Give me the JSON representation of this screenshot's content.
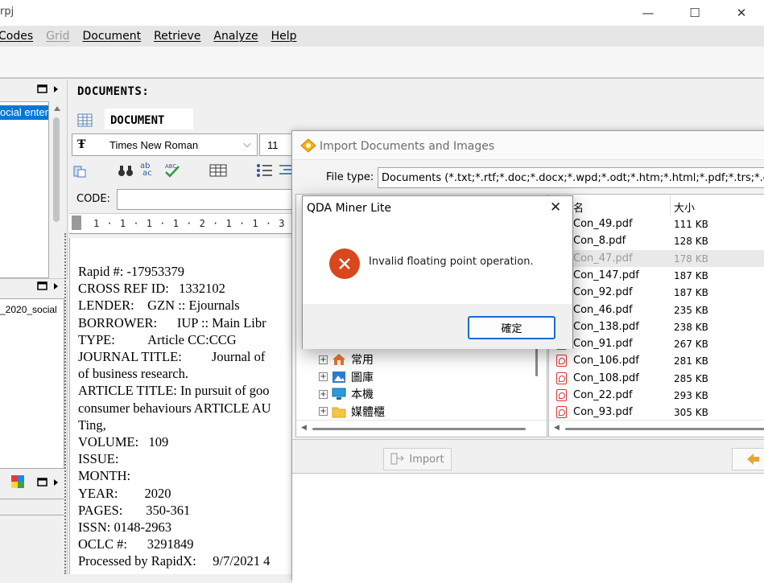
{
  "window": {
    "title": "rpj",
    "minimize": "—",
    "maximize": "☐",
    "close": "✕"
  },
  "menu": [
    {
      "label": "Codes",
      "disabled": false
    },
    {
      "label": "Grid",
      "disabled": true
    },
    {
      "label": "Document",
      "disabled": false
    },
    {
      "label": "Retrieve",
      "disabled": false
    },
    {
      "label": "Analyze",
      "disabled": false
    },
    {
      "label": "Help",
      "disabled": false
    }
  ],
  "left_panels": {
    "top_item": "ocial enter",
    "mid_item": "_2020_social"
  },
  "documents": {
    "header": "DOCUMENTS:",
    "tab": "DOCUMENT",
    "font": "Times New Roman",
    "size": "11",
    "code_label": "CODE:",
    "ruler": "1 · 1 · 1 · 1 · 2 · 1 · 1 · 3 · 1 · 1 · 4 · 1 · 1 · 5 · 1",
    "lines": [
      "Rapid #: -17953379",
      "CROSS REF ID:   1332102",
      "LENDER:    GZN :: Ejournals",
      "BORROWER:      IUP :: Main Libr",
      "TYPE:          Article CC:CCG",
      "JOURNAL TITLE:         Journal of",
      "of business research.",
      "ARTICLE TITLE: In pursuit of goo",
      "consumer behaviours ARTICLE AU",
      "Ting,",
      "VOLUME:   109",
      "ISSUE:",
      "MONTH:",
      "YEAR:        2020",
      "PAGES:       350-361",
      "ISSN: 0148-2963",
      "OCLC #:      3291849",
      "Processed by RapidX:     9/7/2021 4"
    ]
  },
  "import_dialog": {
    "title": "Import Documents and Images",
    "file_type_label": "File type:",
    "file_type_value": "Documents (*.txt;*.rtf;*.doc;*.docx;*.wpd;*.odt;*.htm;*.html;*.pdf;*.trs;*.c",
    "col_name": "名",
    "col_size": "大小",
    "files": [
      {
        "name": "Con_49.pdf",
        "size": "111 KB",
        "selected": false
      },
      {
        "name": "Con_8.pdf",
        "size": "128 KB",
        "selected": false
      },
      {
        "name": "Con_47.pdf",
        "size": "178 KB",
        "selected": true
      },
      {
        "name": "Con_147.pdf",
        "size": "187 KB",
        "selected": false
      },
      {
        "name": "Con_92.pdf",
        "size": "187 KB",
        "selected": false
      },
      {
        "name": "Con_46.pdf",
        "size": "235 KB",
        "selected": false
      },
      {
        "name": "Con_138.pdf",
        "size": "238 KB",
        "selected": false
      },
      {
        "name": "Con_91.pdf",
        "size": "267 KB",
        "selected": false
      },
      {
        "name": "Con_106.pdf",
        "size": "281 KB",
        "selected": false
      },
      {
        "name": "Con_108.pdf",
        "size": "285 KB",
        "selected": false
      },
      {
        "name": "Con_22.pdf",
        "size": "293 KB",
        "selected": false
      },
      {
        "name": "Con_93.pdf",
        "size": "305 KB",
        "selected": false
      }
    ],
    "tree": [
      {
        "label": "常用",
        "icon": "home-icon"
      },
      {
        "label": "圖庫",
        "icon": "gallery-icon"
      },
      {
        "label": "本機",
        "icon": "computer-icon"
      },
      {
        "label": "媒體櫃",
        "icon": "folder-icon"
      }
    ],
    "import_button": "Import"
  },
  "alert": {
    "title": "QDA Miner Lite",
    "message": "Invalid floating point operation.",
    "ok": "確定",
    "icon": "error-icon",
    "icon_color": "#d9471c"
  },
  "colors": {
    "menubar": "#e6e6e6",
    "selection": "#0078d7",
    "ok_border": "#1b6ad0"
  }
}
